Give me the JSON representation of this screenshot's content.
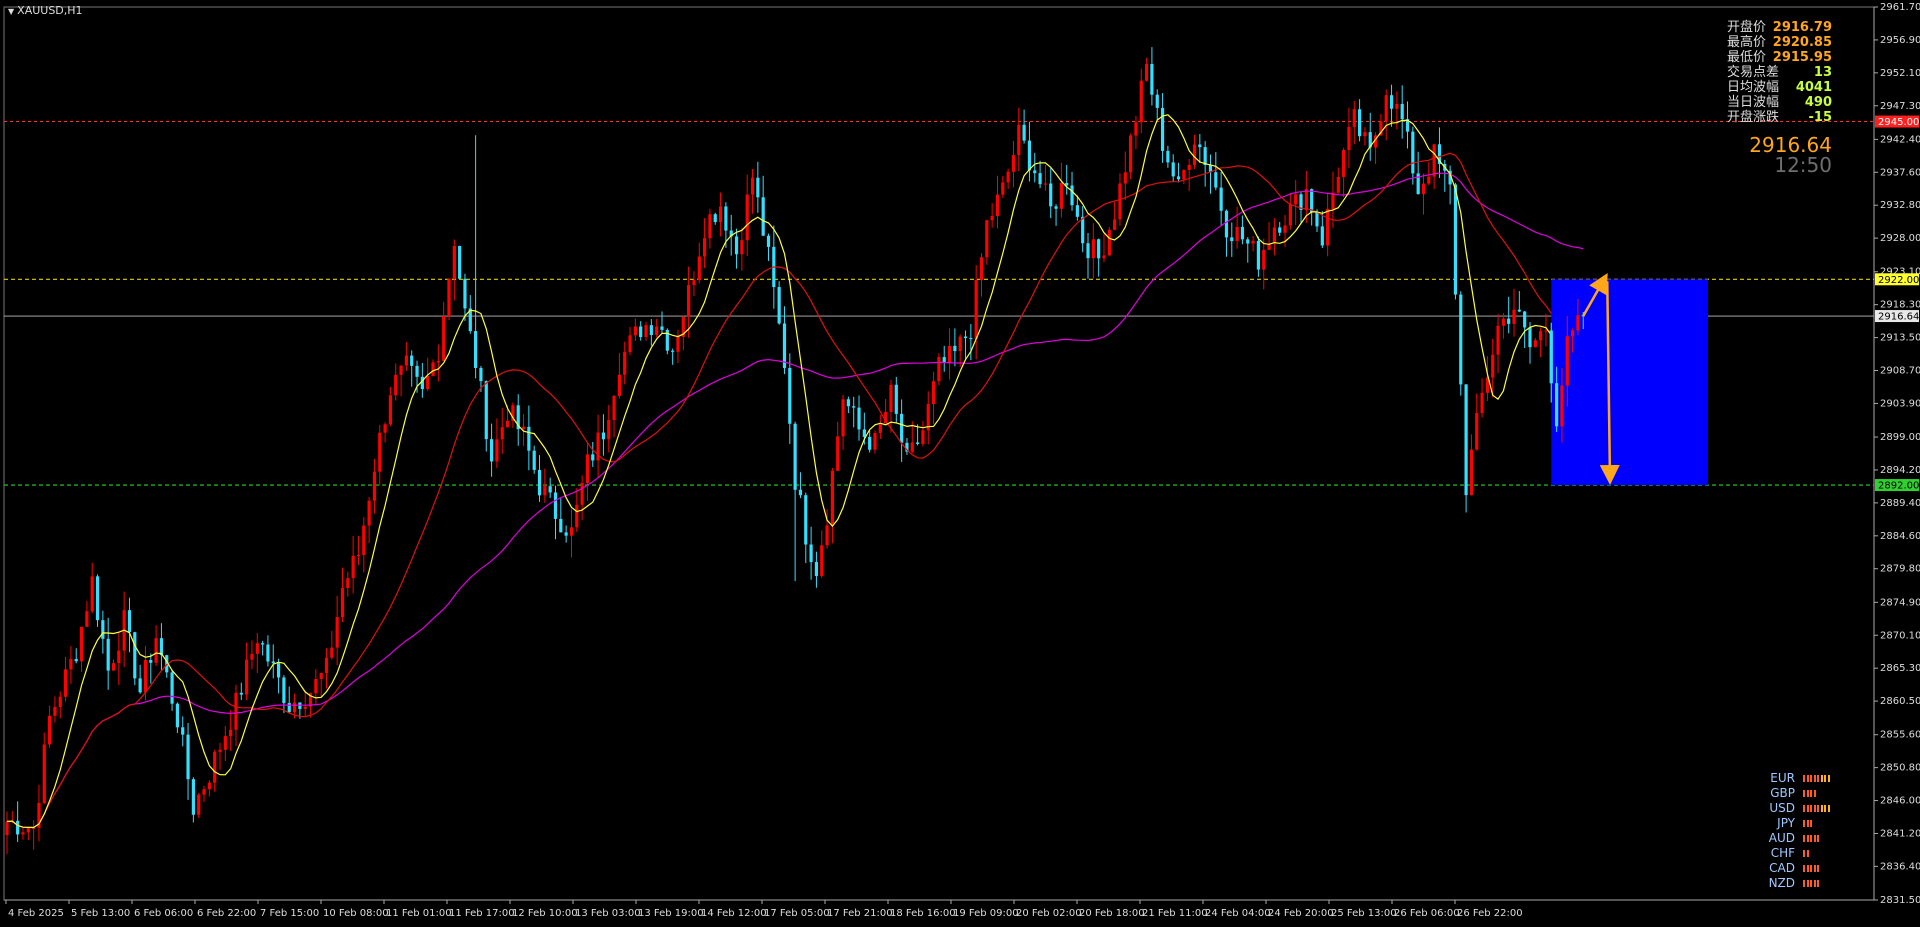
{
  "symbol": "XAUUSD,H1",
  "info_panel": [
    {
      "label": "开盘价",
      "value": "2916.79",
      "color": "#ffa61a"
    },
    {
      "label": "最高价",
      "value": "2920.85",
      "color": "#ffa61a"
    },
    {
      "label": "最低价",
      "value": "2915.95",
      "color": "#ffa61a"
    },
    {
      "label": "交易点差",
      "value": "13",
      "color": "#c6ff3c"
    },
    {
      "label": "日均波幅",
      "value": "4041",
      "color": "#c6ff3c"
    },
    {
      "label": "当日波幅",
      "value": "490",
      "color": "#c6ff3c"
    },
    {
      "label": "开盘涨跌",
      "value": "-15",
      "color": "#c6ff3c"
    }
  ],
  "current_price": "2916.64",
  "timer": "12:50",
  "price_axis": {
    "min": 2831.5,
    "max": 2961.7,
    "labels": [
      "2961.70",
      "2956.90",
      "2952.10",
      "2947.30",
      "2942.40",
      "2937.60",
      "2932.80",
      "2928.00",
      "2923.10",
      "2918.30",
      "2913.50",
      "2908.70",
      "2903.90",
      "2899.00",
      "2894.20",
      "2889.40",
      "2884.60",
      "2879.80",
      "2874.90",
      "2870.10",
      "2865.30",
      "2860.50",
      "2855.60",
      "2850.80",
      "2846.00",
      "2841.20",
      "2836.40",
      "2831.50"
    ]
  },
  "time_axis": [
    "4 Feb 2025",
    "5 Feb 13:00",
    "6 Feb 06:00",
    "6 Feb 22:00",
    "7 Feb 15:00",
    "10 Feb 08:00",
    "11 Feb 01:00",
    "11 Feb 17:00",
    "12 Feb 10:00",
    "13 Feb 03:00",
    "13 Feb 19:00",
    "14 Feb 12:00",
    "17 Feb 05:00",
    "17 Feb 21:00",
    "18 Feb 16:00",
    "19 Feb 09:00",
    "20 Feb 02:00",
    "20 Feb 18:00",
    "21 Feb 11:00",
    "24 Feb 04:00",
    "24 Feb 20:00",
    "25 Feb 13:00",
    "26 Feb 06:00",
    "26 Feb 22:00"
  ],
  "chart_data": {
    "type": "candlestick",
    "symbol": "XAUUSD",
    "timeframe": "H1",
    "candle_count": 226,
    "ylim": [
      2831.5,
      2961.7
    ],
    "path_points": [
      {
        "i": 0,
        "p": 2843
      },
      {
        "i": 5,
        "p": 2842
      },
      {
        "i": 8,
        "p": 2858
      },
      {
        "i": 13,
        "p": 2868
      },
      {
        "i": 16,
        "p": 2878
      },
      {
        "i": 19,
        "p": 2865
      },
      {
        "i": 22,
        "p": 2872
      },
      {
        "i": 25,
        "p": 2862
      },
      {
        "i": 28,
        "p": 2870
      },
      {
        "i": 32,
        "p": 2858
      },
      {
        "i": 35,
        "p": 2845
      },
      {
        "i": 38,
        "p": 2850
      },
      {
        "i": 43,
        "p": 2860
      },
      {
        "i": 47,
        "p": 2870
      },
      {
        "i": 50,
        "p": 2865
      },
      {
        "i": 53,
        "p": 2860
      },
      {
        "i": 57,
        "p": 2862
      },
      {
        "i": 60,
        "p": 2865
      },
      {
        "i": 63,
        "p": 2877
      },
      {
        "i": 66,
        "p": 2882
      },
      {
        "i": 69,
        "p": 2895
      },
      {
        "i": 72,
        "p": 2906
      },
      {
        "i": 75,
        "p": 2909
      },
      {
        "i": 78,
        "p": 2905
      },
      {
        "i": 81,
        "p": 2912
      },
      {
        "i": 84,
        "p": 2928
      },
      {
        "i": 86,
        "p": 2917
      },
      {
        "i": 88,
        "p": 2910
      },
      {
        "i": 91,
        "p": 2896
      },
      {
        "i": 94,
        "p": 2903
      },
      {
        "i": 97,
        "p": 2899
      },
      {
        "i": 100,
        "p": 2892
      },
      {
        "i": 103,
        "p": 2888
      },
      {
        "i": 106,
        "p": 2885
      },
      {
        "i": 109,
        "p": 2895
      },
      {
        "i": 112,
        "p": 2900
      },
      {
        "i": 115,
        "p": 2910
      },
      {
        "i": 119,
        "p": 2915
      },
      {
        "i": 122,
        "p": 2916
      },
      {
        "i": 125,
        "p": 2912
      },
      {
        "i": 128,
        "p": 2920
      },
      {
        "i": 131,
        "p": 2930
      },
      {
        "i": 134,
        "p": 2933
      },
      {
        "i": 137,
        "p": 2926
      },
      {
        "i": 140,
        "p": 2937
      },
      {
        "i": 143,
        "p": 2925
      },
      {
        "i": 146,
        "p": 2910
      },
      {
        "i": 148,
        "p": 2893
      },
      {
        "i": 150,
        "p": 2885
      },
      {
        "i": 152,
        "p": 2880
      },
      {
        "i": 154,
        "p": 2888
      },
      {
        "i": 157,
        "p": 2905
      },
      {
        "i": 160,
        "p": 2900
      },
      {
        "i": 163,
        "p": 2898
      },
      {
        "i": 166,
        "p": 2905
      },
      {
        "i": 169,
        "p": 2895
      },
      {
        "i": 172,
        "p": 2900
      },
      {
        "i": 175,
        "p": 2909
      },
      {
        "i": 178,
        "p": 2911
      },
      {
        "i": 181,
        "p": 2915
      },
      {
        "i": 184,
        "p": 2930
      },
      {
        "i": 187,
        "p": 2935
      },
      {
        "i": 190,
        "p": 2943
      },
      {
        "i": 193,
        "p": 2938
      },
      {
        "i": 196,
        "p": 2932
      },
      {
        "i": 199,
        "p": 2937
      },
      {
        "i": 202,
        "p": 2928
      },
      {
        "i": 205,
        "p": 2925
      },
      {
        "i": 208,
        "p": 2932
      },
      {
        "i": 211,
        "p": 2942
      },
      {
        "i": 214,
        "p": 2953
      },
      {
        "i": 217,
        "p": 2942
      },
      {
        "i": 220,
        "p": 2935
      },
      {
        "i": 223,
        "p": 2943
      },
      {
        "i": 226,
        "p": 2938
      },
      {
        "i": 229,
        "p": 2930
      },
      {
        "i": 232,
        "p": 2928
      },
      {
        "i": 235,
        "p": 2925
      },
      {
        "i": 238,
        "p": 2930
      },
      {
        "i": 241,
        "p": 2932
      },
      {
        "i": 244,
        "p": 2935
      },
      {
        "i": 247,
        "p": 2928
      },
      {
        "i": 250,
        "p": 2938
      },
      {
        "i": 253,
        "p": 2945
      },
      {
        "i": 256,
        "p": 2940
      },
      {
        "i": 259,
        "p": 2950
      },
      {
        "i": 262,
        "p": 2945
      },
      {
        "i": 265,
        "p": 2935
      },
      {
        "i": 268,
        "p": 2940
      },
      {
        "i": 271,
        "p": 2935
      },
      {
        "i": 274,
        "p": 2892
      },
      {
        "i": 277,
        "p": 2905
      },
      {
        "i": 280,
        "p": 2915
      },
      {
        "i": 283,
        "p": 2918
      },
      {
        "i": 286,
        "p": 2912
      },
      {
        "i": 289,
        "p": 2915
      },
      {
        "i": 291,
        "p": 2902
      },
      {
        "i": 293,
        "p": 2912
      },
      {
        "i": 296,
        "p": 2916.6
      }
    ],
    "support_level": 2892.0,
    "resistance_level": 2922.0,
    "top_level": 2945.0,
    "current_price": 2916.64,
    "projected_move": {
      "up_to": 2922.0,
      "down_to": 2892.0
    },
    "moving_averages": [
      "yellow-fast",
      "red-medium",
      "magenta-slow"
    ]
  },
  "price_tags": {
    "top": "2945.00",
    "resistance": "2922.00",
    "current": "2916.64",
    "support": "2892.00"
  },
  "strength_meter": [
    {
      "currency": "EUR",
      "bars": [
        1,
        1,
        1,
        1,
        1,
        2,
        2,
        2
      ]
    },
    {
      "currency": "GBP",
      "bars": [
        1,
        1,
        1,
        1
      ]
    },
    {
      "currency": "USD",
      "bars": [
        1,
        1,
        1,
        1,
        1,
        2,
        2,
        2
      ]
    },
    {
      "currency": "JPY",
      "bars": [
        1,
        1,
        1
      ]
    },
    {
      "currency": "AUD",
      "bars": [
        1,
        1,
        1,
        1,
        1
      ]
    },
    {
      "currency": "CHF",
      "bars": [
        1,
        1
      ]
    },
    {
      "currency": "CAD",
      "bars": [
        1,
        1,
        1,
        1,
        1
      ]
    },
    {
      "currency": "NZD",
      "bars": [
        1,
        1,
        1,
        1,
        1
      ]
    }
  ],
  "colors": {
    "bull": "#ff0000",
    "bear": "#33e0ff",
    "zone": "#0000ff",
    "arrow": "#ffa61a",
    "support_line": "#2bd12b",
    "resistance_line": "#e0d000",
    "top_line": "#ff3030",
    "ma_fast": "#ffff3c",
    "ma_mid": "#e01010",
    "ma_slow": "#e000e0"
  }
}
